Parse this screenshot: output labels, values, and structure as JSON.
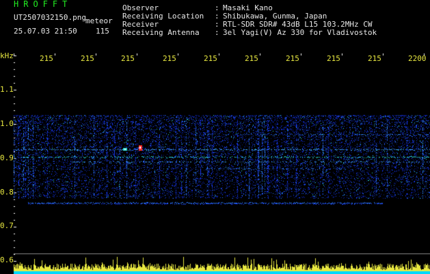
{
  "header": {
    "brand": "HROFFT",
    "filename": "UT2507032150.png",
    "mode": "meteor",
    "datetime": "25.07.03 21:50",
    "count": "115",
    "info": [
      {
        "label": "Observer",
        "value": "Masaki Kano"
      },
      {
        "label": "Receiving Location",
        "value": "Shibukawa, Gunma, Japan"
      },
      {
        "label": "Receiver",
        "value": "RTL-SDR SDR# 43dB L15 103.2MHz CW"
      },
      {
        "label": "Receiving Antenna",
        "value": "3el Yagi(V) Az 330 for Vladivostok"
      }
    ]
  },
  "axis": {
    "y_unit": "kHz",
    "y_ticks": [
      "1.1",
      "1.0",
      "0.9",
      "0.8",
      "0.7",
      "0.6"
    ],
    "x_ticks": [
      "215",
      "215",
      "215",
      "215",
      "215",
      "215",
      "215",
      "215",
      "215",
      "2200"
    ]
  },
  "colors": {
    "text_green": "#22ee22",
    "text_white": "#e8e8e8",
    "text_yellow": "#e8e840",
    "noise_blue": "#1a3cff",
    "meteor_red": "#ff2a2a",
    "bar_cyan": "#00d8ff"
  }
}
